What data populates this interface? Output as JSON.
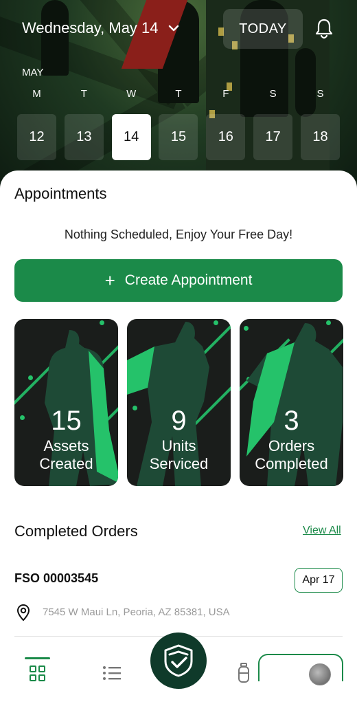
{
  "header": {
    "date_label": "Wednesday, May 14",
    "today_label": "TODAY",
    "month_label": "MAY",
    "weekdays": [
      "M",
      "T",
      "W",
      "T",
      "F",
      "S",
      "S"
    ],
    "days": [
      "12",
      "13",
      "14",
      "15",
      "16",
      "17",
      "18"
    ],
    "selected_day": "14"
  },
  "appointments": {
    "title": "Appointments",
    "empty_message": "Nothing Scheduled, Enjoy Your Free Day!",
    "create_label": "Create Appointment"
  },
  "stats": [
    {
      "value": "15",
      "label_line1": "Assets",
      "label_line2": "Created"
    },
    {
      "value": "9",
      "label_line1": "Units",
      "label_line2": "Serviced"
    },
    {
      "value": "3",
      "label_line1": "Orders",
      "label_line2": "Completed"
    }
  ],
  "completed_orders": {
    "title": "Completed Orders",
    "view_all_label": "View All",
    "orders": [
      {
        "id": "FSO 00003545",
        "date": "Apr 17",
        "address": "7545 W Maui Ln, Peoria, AZ 85381, USA"
      }
    ]
  },
  "colors": {
    "accent": "#1b8a49",
    "card_bg": "#1a1d1b",
    "fab_bg": "#0f3a2a",
    "stat_green": "#25c26a"
  },
  "icons": {
    "chevron": "chevron-down-icon",
    "bell": "bell-icon",
    "plus": "plus-icon",
    "pin": "location-pin-icon",
    "nav_dashboard": "grid-icon",
    "nav_list": "list-icon",
    "nav_center": "shield-check-icon",
    "nav_tank": "tank-icon"
  }
}
